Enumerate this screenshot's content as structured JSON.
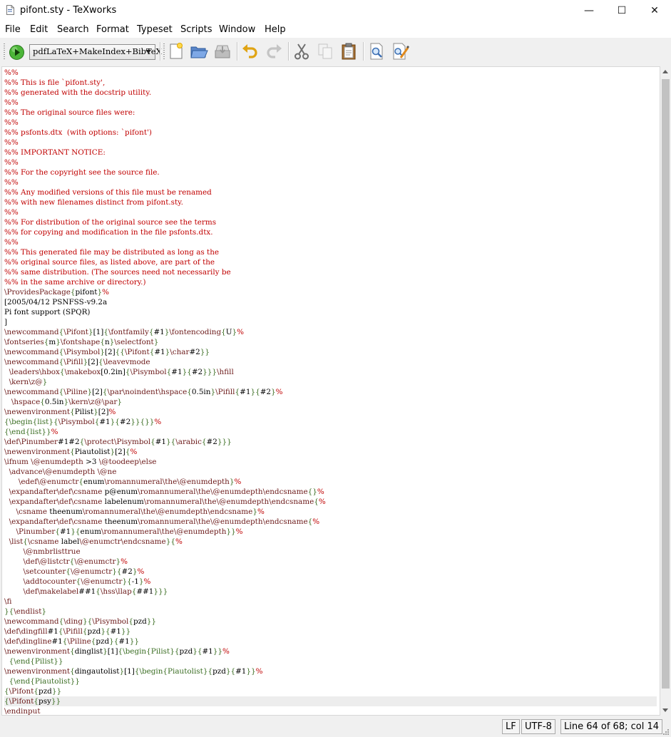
{
  "window": {
    "title": "pifont.sty - TeXworks"
  },
  "window_controls": {
    "minimize": "—",
    "maximize": "☐",
    "close": "✕"
  },
  "menu": [
    "File",
    "Edit",
    "Search",
    "Format",
    "Typeset",
    "Scripts",
    "Window",
    "Help"
  ],
  "toolbar": {
    "typeset_engine": "pdfLaTeX+MakeIndex+BibTeX",
    "icons": [
      "typeset-run-icon",
      "new-document-icon",
      "open-folder-icon",
      "save-icon",
      "undo-icon",
      "redo-icon",
      "cut-icon",
      "copy-icon",
      "paste-icon",
      "find-icon",
      "replace-icon"
    ]
  },
  "editor": {
    "lines": [
      "%%",
      "%% This is file `pifont.sty',",
      "%% generated with the docstrip utility.",
      "%%",
      "%% The original source files were:",
      "%%",
      "%% psfonts.dtx  (with options: `pifont')",
      "%%",
      "%% IMPORTANT NOTICE:",
      "%%",
      "%% For the copyright see the source file.",
      "%%",
      "%% Any modified versions of this file must be renamed",
      "%% with new filenames distinct from pifont.sty.",
      "%%",
      "%% For distribution of the original source see the terms",
      "%% for copying and modification in the file psfonts.dtx.",
      "%%",
      "%% This generated file may be distributed as long as the",
      "%% original source files, as listed above, are part of the",
      "%% same distribution. (The sources need not necessarily be",
      "%% in the same archive or directory.)",
      "\\ProvidesPackage{pifont}%",
      "[2005/04/12 PSNFSS-v9.2a",
      "Pi font support (SPQR)",
      "]",
      "\\newcommand{\\Pifont}[1]{\\fontfamily{#1}\\fontencoding{U}%",
      "\\fontseries{m}\\fontshape{n}\\selectfont}",
      "\\newcommand{\\Pisymbol}[2]{{\\Pifont{#1}\\char#2}}",
      "\\newcommand{\\Pifill}[2]{\\leavevmode",
      "  \\leaders\\hbox{\\makebox[0.2in]{\\Pisymbol{#1}{#2}}}\\hfill",
      "  \\kern\\z@}",
      "\\newcommand{\\Piline}[2]{\\par\\noindent\\hspace{0.5in}\\Pifill{#1}{#2}%",
      "   \\hspace{0.5in}\\kern\\z@\\par}",
      "\\newenvironment{Pilist}[2]%",
      "{\\begin{list}{\\Pisymbol{#1}{#2}}{}}%",
      "{\\end{list}}%",
      "\\def\\Pinumber#1#2{\\protect\\Pisymbol{#1}{\\arabic{#2}}}",
      "\\newenvironment{Piautolist}[2]{%",
      "\\ifnum \\@enumdepth >3 \\@toodeep\\else",
      "  \\advance\\@enumdepth \\@ne",
      "      \\edef\\@enumctr{enum\\romannumeral\\the\\@enumdepth}%",
      "  \\expandafter\\def\\csname p@enum\\romannumeral\\the\\@enumdepth\\endcsname{}%",
      "  \\expandafter\\def\\csname labelenum\\romannumeral\\the\\@enumdepth\\endcsname{%",
      "     \\csname theenum\\romannumeral\\the\\@enumdepth\\endcsname}%",
      "  \\expandafter\\def\\csname theenum\\romannumeral\\the\\@enumdepth\\endcsname{%",
      "     \\Pinumber{#1}{enum\\romannumeral\\the\\@enumdepth}}%",
      "  \\list{\\csname label\\@enumctr\\endcsname}{%",
      "        \\@nmbrlisttrue",
      "        \\def\\@listctr{\\@enumctr}%",
      "        \\setcounter{\\@enumctr}{#2}%",
      "        \\addtocounter{\\@enumctr}{-1}%",
      "        \\def\\makelabel##1{\\hss\\llap{##1}}}",
      "\\fi",
      "}{\\endlist}",
      "\\newcommand{\\ding}{\\Pisymbol{pzd}}",
      "\\def\\dingfill#1{\\Pifill{pzd}{#1}}",
      "\\def\\dingline#1{\\Piline{pzd}{#1}}",
      "\\newenvironment{dinglist}[1]{\\begin{Pilist}{pzd}{#1}}%",
      "  {\\end{Pilist}}",
      "\\newenvironment{dingautolist}[1]{\\begin{Piautolist}{pzd}{#1}}%",
      "  {\\end{Piautolist}}",
      "{\\Pifont{pzd}}",
      "{\\Pifont{psy}}",
      "\\endinput"
    ],
    "current_line": 64
  },
  "status": {
    "line_ending": "LF",
    "encoding": "UTF-8",
    "position": "Line 64 of 68; col 14"
  },
  "colors": {
    "comment": "#c00000",
    "command": "#6c1a1a",
    "environment": "#3a6d22",
    "text": "#000000"
  }
}
